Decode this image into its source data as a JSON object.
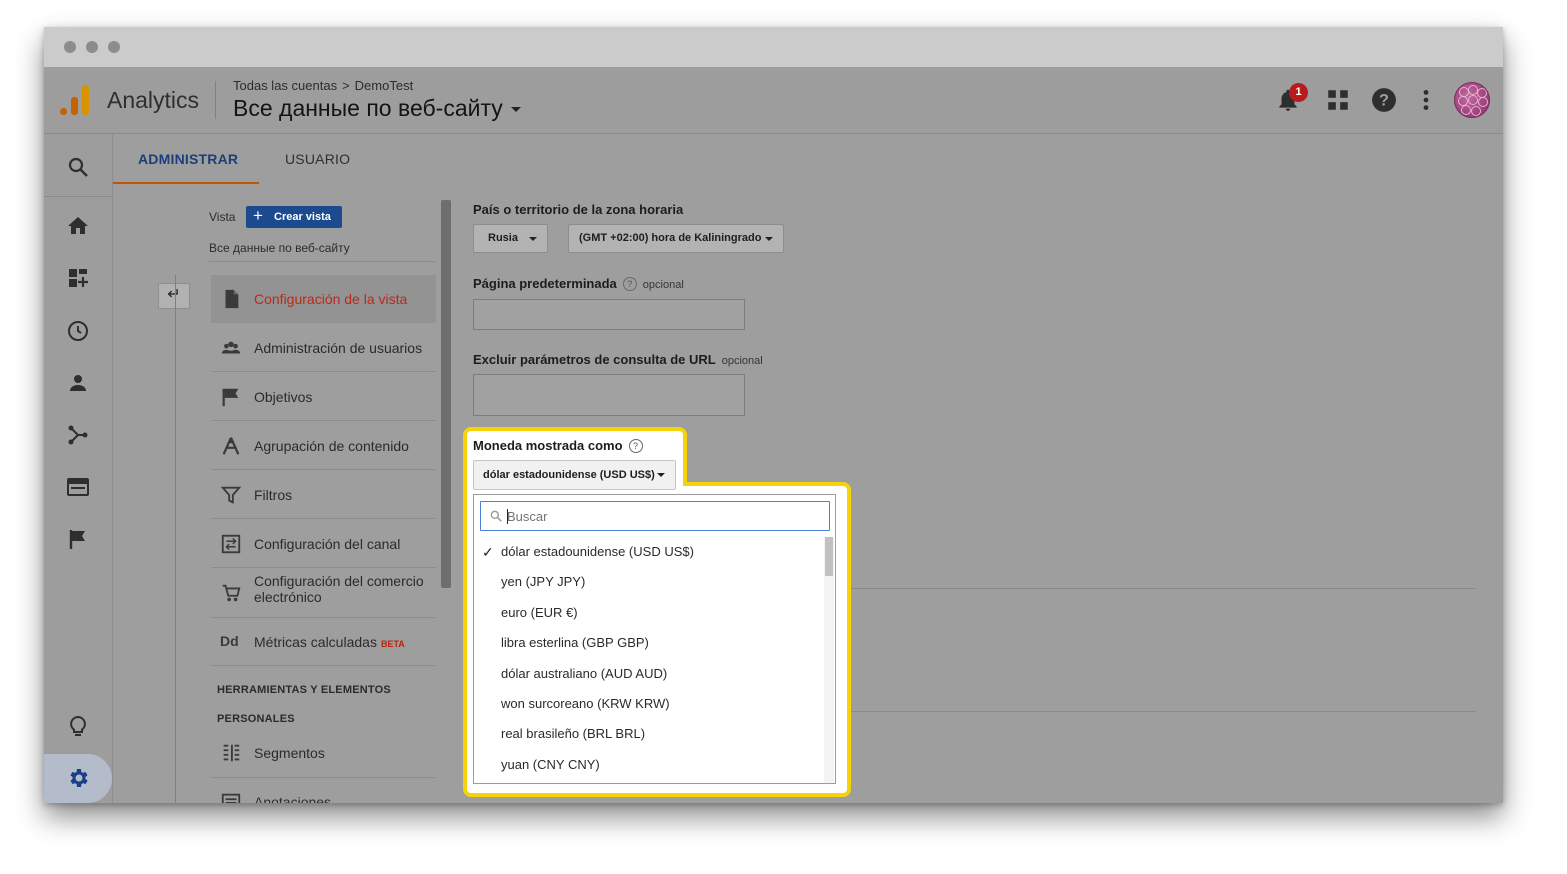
{
  "header": {
    "app_name": "Analytics",
    "breadcrumb": [
      "Todas las cuentas",
      "DemoTest"
    ],
    "breadcrumb_sep": ">",
    "view_title": "Все данные по веб-сайту",
    "notification_count": "1"
  },
  "tabs": [
    {
      "label": "ADMINISTRAR",
      "active": true
    },
    {
      "label": "USUARIO",
      "active": false
    }
  ],
  "nav": {
    "vista_label": "Vista",
    "create_button": "Crear vista",
    "view_name": "Все данные по веб-сайту",
    "items": [
      {
        "label": "Configuración de la vista",
        "icon": "document-icon",
        "active": true
      },
      {
        "label": "Administración de usuarios",
        "icon": "people-icon"
      },
      {
        "label": "Objetivos",
        "icon": "flag-icon"
      },
      {
        "label": "Agrupación de contenido",
        "icon": "content-grouping-icon"
      },
      {
        "label": "Filtros",
        "icon": "filter-icon"
      },
      {
        "label": "Configuración del canal",
        "icon": "channel-settings-icon"
      },
      {
        "label": "Configuración del comercio electrónico",
        "icon": "cart-icon"
      },
      {
        "label": "Métricas calculadas",
        "icon": "calculated-metrics-icon",
        "badge": "BETA",
        "icon_text": "Dd"
      }
    ],
    "tools_heading_line1": "HERRAMIENTAS Y ELEMENTOS",
    "tools_heading_line2": "PERSONALES",
    "tools_items": [
      {
        "label": "Segmentos",
        "icon": "segments-icon"
      },
      {
        "label": "Anotaciones",
        "icon": "annotations-icon"
      }
    ]
  },
  "form": {
    "timezone_label": "País o territorio de la zona horaria",
    "country_value": "Rusia",
    "timezone_value": "(GMT +02:00) hora de Kaliningrado",
    "default_page_label": "Página predeterminada",
    "default_page_optional": "opcional",
    "default_page_value": "",
    "exclude_params_label": "Excluir parámetros de consulta de URL",
    "exclude_params_optional": "opcional",
    "exclude_params_value": "",
    "currency_label": "Moneda mostrada como",
    "currency_value": "dólar estadounidense (USD US$)",
    "help_glyph": "?"
  },
  "currency_dropdown": {
    "search_placeholder": "Buscar",
    "search_value": "",
    "options": [
      {
        "label": "dólar estadounidense (USD US$)",
        "selected": true
      },
      {
        "label": "yen (JPY JPY)"
      },
      {
        "label": "euro (EUR €)"
      },
      {
        "label": "libra esterlina (GBP GBP)"
      },
      {
        "label": "dólar australiano (AUD AUD)"
      },
      {
        "label": "won surcoreano (KRW KRW)"
      },
      {
        "label": "real brasileño (BRL BRL)"
      },
      {
        "label": "yuan (CNY CNY)"
      }
    ]
  },
  "colors": {
    "highlight": "#f5d30a",
    "active_tab": "#1b3f78",
    "active_nav": "#b92a1a",
    "logo_orange": "#e37400",
    "logo_yellow": "#f9ab00"
  }
}
